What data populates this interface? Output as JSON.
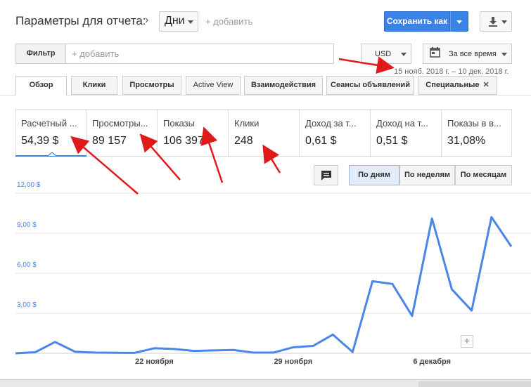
{
  "header": {
    "title": "Параметры для отчета:",
    "granularity_select": "Дни",
    "add_link": "+ добавить",
    "save_label": "Сохранить как"
  },
  "filter": {
    "button_label": "Фильтр",
    "placeholder": "+ добавить"
  },
  "currency": "USD",
  "period": {
    "label": "За все время",
    "range": "15 нояб. 2018 г. – 10 дек. 2018 г."
  },
  "tabs": [
    {
      "label": "Обзор"
    },
    {
      "label": "Клики"
    },
    {
      "label": "Просмотры"
    },
    {
      "label": "Active View"
    },
    {
      "label": "Взаимодействия"
    },
    {
      "label": "Сеансы объявлений"
    },
    {
      "label": "Специальные"
    }
  ],
  "metrics": [
    {
      "label": "Расчетный ...",
      "value": "54,39 $"
    },
    {
      "label": "Просмотры...",
      "value": "89 157"
    },
    {
      "label": "Показы",
      "value": "106 397"
    },
    {
      "label": "Клики",
      "value": "248"
    },
    {
      "label": "Доход за т...",
      "value": "0,61 $"
    },
    {
      "label": "Доход на т...",
      "value": "0,51 $"
    },
    {
      "label": "Показы в в...",
      "value": "31,08%"
    }
  ],
  "granularity_buttons": [
    {
      "label": "По дням"
    },
    {
      "label": "По неделям"
    },
    {
      "label": "По месяцам"
    }
  ],
  "colors": {
    "accent": "#3b82e5",
    "line": "#4a86e8",
    "arrow": "#e0191b"
  },
  "chart_data": {
    "type": "line",
    "y_ticks": [
      "12,00 $",
      "9,00 $",
      "6,00 $",
      "3,00 $"
    ],
    "y_tick_values": [
      12,
      9,
      6,
      3
    ],
    "ylim": [
      0,
      12
    ],
    "x_labels": [
      "22 ноября",
      "29 ноября",
      "6 декабря"
    ],
    "x_label_index": [
      7,
      14,
      21
    ],
    "x": [
      "15 нояб.",
      "16 нояб.",
      "17 нояб.",
      "18 нояб.",
      "19 нояб.",
      "20 нояб.",
      "21 нояб.",
      "22 нояб.",
      "23 нояб.",
      "24 нояб.",
      "25 нояб.",
      "26 нояб.",
      "27 нояб.",
      "28 нояб.",
      "29 нояб.",
      "30 нояб.",
      "1 дек.",
      "2 дек.",
      "3 дек.",
      "4 дек.",
      "5 дек.",
      "6 дек.",
      "7 дек.",
      "8 дек.",
      "9 дек.",
      "10 дек."
    ],
    "values": [
      0.0,
      0.08,
      0.85,
      0.12,
      0.05,
      0.04,
      0.03,
      0.38,
      0.32,
      0.18,
      0.22,
      0.25,
      0.05,
      0.05,
      0.45,
      0.55,
      1.4,
      0.1,
      5.4,
      5.2,
      2.8,
      10.1,
      4.8,
      3.2,
      10.2,
      8.0
    ],
    "grid": true
  }
}
